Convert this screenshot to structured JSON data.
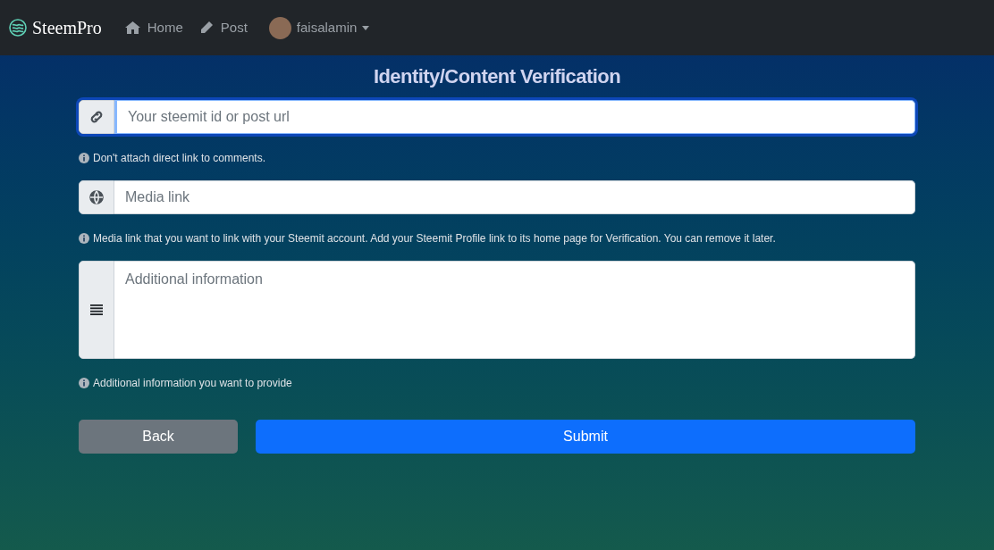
{
  "navbar": {
    "brand": "SteemPro",
    "links": [
      {
        "label": "Home"
      },
      {
        "label": "Post"
      }
    ],
    "user": {
      "name": "faisalamin"
    }
  },
  "title": "Identity/Content Verification",
  "fields": [
    {
      "kind": "input",
      "placeholder": "Your steemit id or post url",
      "focused": true,
      "hint": "Don't attach direct link to comments."
    },
    {
      "kind": "input",
      "placeholder": "Media link",
      "focused": false,
      "hint": "Media link that you want to link with your Steemit account. Add your Steemit Profile link to its home page for Verification. You can remove it later."
    },
    {
      "kind": "textarea",
      "placeholder": "Additional information",
      "focused": false,
      "hint": "Additional information you want to provide"
    }
  ],
  "buttons": [
    {
      "label": "Back",
      "kind": "secondary"
    },
    {
      "label": "Submit",
      "kind": "primary"
    }
  ]
}
